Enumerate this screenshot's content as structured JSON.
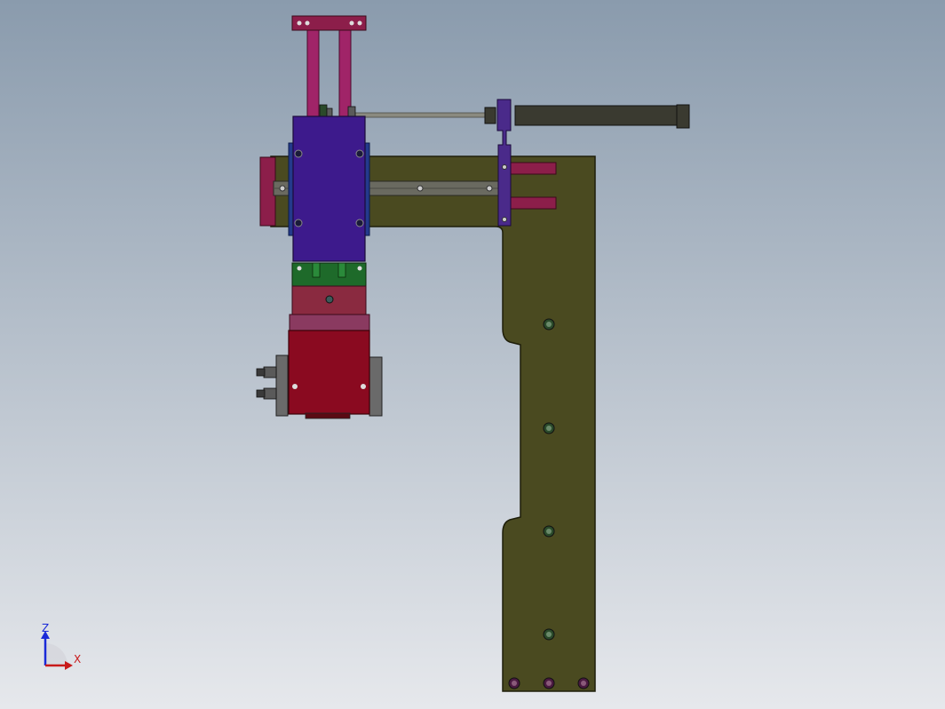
{
  "viewport": {
    "background_top": "#8a9bad",
    "background_bottom": "#e6e8ec"
  },
  "model": {
    "colors": {
      "base_plate": "#4a4a20",
      "base_plate_edge": "#1e1e0a",
      "carriage": "#3d1a8c",
      "carriage_side": "#243a8c",
      "top_bracket": "#8c1e4a",
      "guide_rods": "#a02468",
      "rail": "#6a6a60",
      "cylinder_body": "#3a3a30",
      "cylinder_rod": "#8a8a80",
      "cylinder_bracket": "#4a2a8a",
      "stopper": "#8c1e4a",
      "green_block": "#1e6a2a",
      "adapter_block": "#8a2a40",
      "gripper": "#8a0a20",
      "gripper_jaw": "#6a6a6a",
      "bolt": "#3a3a3a",
      "bolt_hole": "#2a4a2a"
    }
  },
  "triad": {
    "z_label": "Z",
    "x_label": "X",
    "z_color": "#1a2ad8",
    "x_color": "#c81a1a"
  }
}
